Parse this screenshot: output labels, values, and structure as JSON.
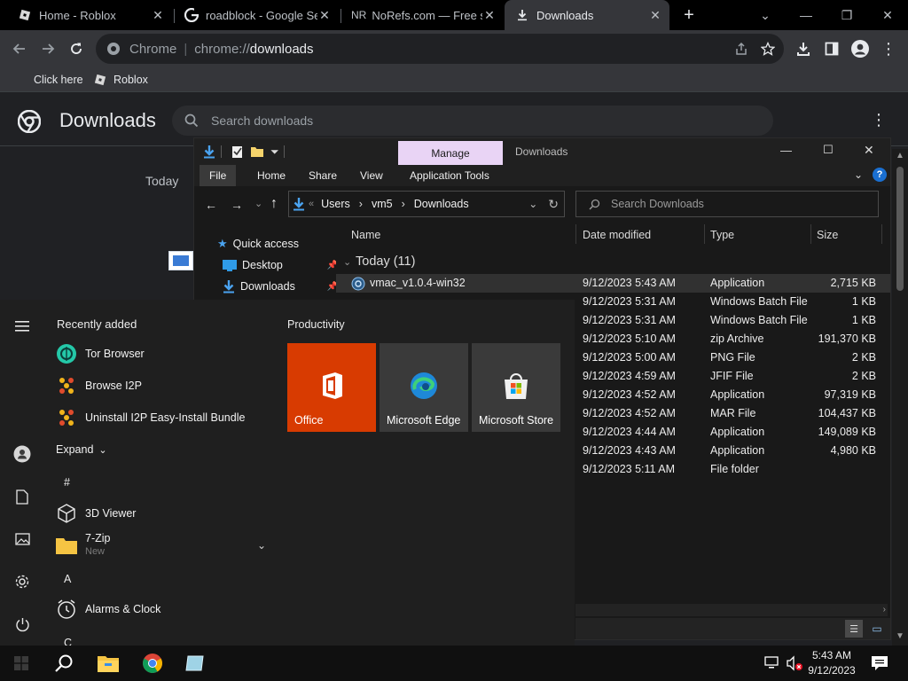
{
  "browser": {
    "tabs": [
      {
        "label": "Home - Roblox",
        "icon": "roblox-icon"
      },
      {
        "label": "roadblock - Google Sea",
        "icon": "google-icon"
      },
      {
        "label": "NoRefs.com — Free se",
        "icon": "norefs-icon",
        "icon_text": "NR"
      },
      {
        "label": "Downloads",
        "icon": "download-icon",
        "active": true
      }
    ],
    "new_tab_label": "+",
    "omnibox": {
      "site_label": "Chrome",
      "url_scheme": "chrome://",
      "url_path": "downloads"
    },
    "bookmarks": [
      {
        "label": "Click here"
      },
      {
        "label": "Roblox",
        "icon": "roblox-icon"
      }
    ]
  },
  "downloads_page": {
    "title": "Downloads",
    "search_placeholder": "Search downloads",
    "group_label": "Today"
  },
  "explorer": {
    "title": "Downloads",
    "contextual_tab": "Manage",
    "ribbon_tabs": [
      "File",
      "Home",
      "Share",
      "View",
      "Application Tools"
    ],
    "breadcrumb": [
      "Users",
      "vm5",
      "Downloads"
    ],
    "search_placeholder": "Search Downloads",
    "nav": [
      {
        "label": "Quick access",
        "icon": "star-icon"
      },
      {
        "label": "Desktop",
        "icon": "desktop-icon",
        "pinned": true
      },
      {
        "label": "Downloads",
        "icon": "download-icon",
        "pinned": true
      }
    ],
    "columns": [
      "Name",
      "Date modified",
      "Type",
      "Size"
    ],
    "group": "Today (11)",
    "files": [
      {
        "name": "vmac_v1.0.4-win32",
        "date": "9/12/2023 5:43 AM",
        "type": "Application",
        "size": "2,715 KB"
      },
      {
        "name": "",
        "date": "9/12/2023 5:31 AM",
        "type": "Windows Batch File",
        "size": "1 KB"
      },
      {
        "name": "",
        "date": "9/12/2023 5:31 AM",
        "type": "Windows Batch File",
        "size": "1 KB"
      },
      {
        "name": "",
        "date": "9/12/2023 5:10 AM",
        "type": "zip Archive",
        "size": "191,370 KB"
      },
      {
        "name": "",
        "date": "9/12/2023 5:00 AM",
        "type": "PNG File",
        "size": "2 KB"
      },
      {
        "name": "",
        "date": "9/12/2023 4:59 AM",
        "type": "JFIF File",
        "size": "2 KB"
      },
      {
        "name": "",
        "date": "9/12/2023 4:52 AM",
        "type": "Application",
        "size": "97,319 KB"
      },
      {
        "name": "",
        "date": "9/12/2023 4:52 AM",
        "type": "MAR File",
        "size": "104,437 KB"
      },
      {
        "name": "",
        "date": "9/12/2023 4:44 AM",
        "type": "Application",
        "size": "149,089 KB"
      },
      {
        "name": "",
        "date": "9/12/2023 4:43 AM",
        "type": "Application",
        "size": "4,980 KB"
      },
      {
        "name": "",
        "date": "9/12/2023 5:11 AM",
        "type": "File folder",
        "size": ""
      }
    ]
  },
  "start_menu": {
    "recently_added_label": "Recently added",
    "recent_apps": [
      {
        "label": "Tor Browser",
        "icon": "tor-browser-icon"
      },
      {
        "label": "Browse I2P",
        "icon": "i2p-icon"
      },
      {
        "label": "Uninstall I2P Easy-Install Bundle",
        "icon": "i2p-icon"
      }
    ],
    "expand_label": "Expand",
    "section_hash": "#",
    "apps_hash": [
      {
        "label": "3D Viewer",
        "icon": "3d-viewer-icon"
      },
      {
        "label": "7-Zip",
        "sublabel": "New",
        "icon": "folder-icon"
      }
    ],
    "section_a": "A",
    "apps_a": [
      {
        "label": "Alarms & Clock",
        "icon": "alarm-clock-icon"
      }
    ],
    "section_c": "C",
    "productivity_label": "Productivity",
    "tiles": [
      {
        "label": "Office",
        "icon": "office-icon",
        "color": "#d83b01"
      },
      {
        "label": "Microsoft Edge",
        "icon": "edge-icon",
        "color": "#3a3a3a"
      },
      {
        "label": "Microsoft Store",
        "icon": "store-icon",
        "color": "#3a3a3a"
      }
    ]
  },
  "taskbar": {
    "time": "5:43 AM",
    "date": "9/12/2023"
  }
}
